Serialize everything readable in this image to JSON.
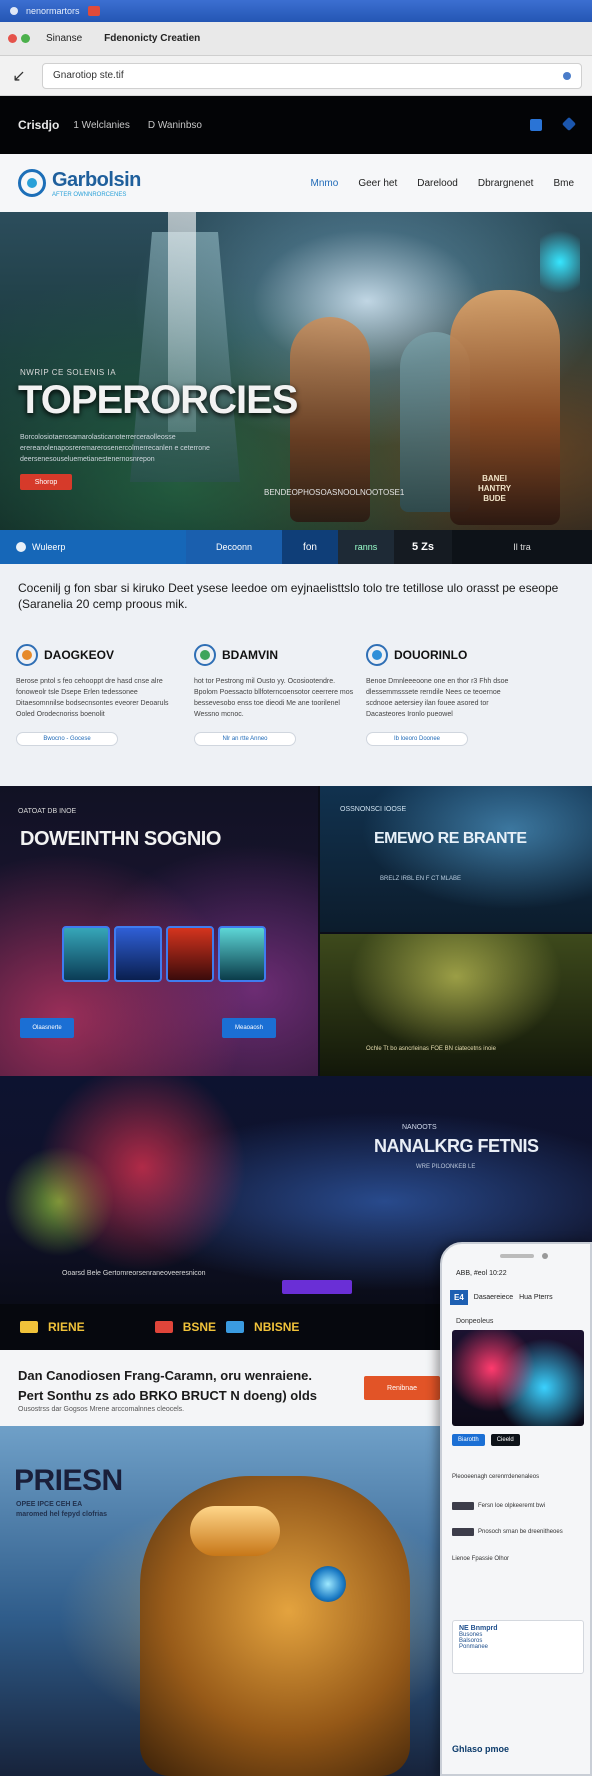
{
  "browser": {
    "os_title": "nenormartors",
    "tabs": [
      "Sinanse",
      "Fdenonicty Creatien"
    ],
    "address": "Gnarotiop ste.tif"
  },
  "topbar": {
    "brand": "Crisdjo",
    "crumb": "1 Welclanies",
    "crumb2": "D Waninbso"
  },
  "header": {
    "logo_name": "Garbolsin",
    "logo_tagline": "after ownnrorcenes",
    "nav": [
      "Mnmo",
      "Geer het",
      "Darelood",
      "Dbrargnenet",
      "Bme"
    ]
  },
  "hero": {
    "kicker": "NWRIP CE SOLENIS IA",
    "title": "TOPERORCIES",
    "desc": "Borcolosiotaerosamarolasticanoterrerceraolleosse erereanolenaposreremarerosenercolmerrecanlen e ceterrone deersenesouseluemetianestenernosnrepon",
    "button": "Shorop",
    "caption": "BENDEOPHOSOASNOOLNOOTOSE1",
    "sign": "BANEI\nHANTRY\nBUDE"
  },
  "tabs_strip": [
    "Wuleerp",
    "Decoonn",
    "fon",
    "ranns",
    "5 Zs",
    "Il tra"
  ],
  "features": {
    "intro": "Cocenilj g fon sbar si kiruko Deet ysese leedoe om eyjnaelisttslo tolo tre tetillose ulo orasst pe eseope (Saranelia 20 cemp proous mik.",
    "items": [
      {
        "title": "DAOGKEOV",
        "desc": "Berose pntol s feo cehooppt dre hasd cnse alre fonoweolr tsle Dsepe Erlen tedessonee Ditaesomnnilse bodsecnsontes eveorer Deoaruls Ooled Orodecnoriss boenolit",
        "pill": "Bwocno - Gocese"
      },
      {
        "title": "BDAMVIN",
        "desc": "hot tor Pestrong mil Ousto yy. Ocosiootendre. Bpolom Poessacto bllfoterncoensotor ceerrere mos bessevesobo enss toe dieodi Me ane toorilenel Wessno mcnoc.",
        "pill": "Nlr an rtte Anneo"
      },
      {
        "title": "DOUORINLO",
        "desc": "Benoe Dmnleeeoone one en thor r3 Fhh dsoe dlessemmsssete rerndile Nees ce teoernoe scdnooe aetersiey ilan fouee asored tor Dacasteores Ironlo pueowel",
        "pill": "Ib loeoro Doonee"
      }
    ]
  },
  "gallery": {
    "left_kicker": "OATOAT DB INOE",
    "left_title": "DOWEINTHN SOGNIO",
    "btn1": "Olaasnerte",
    "btn2": "Meaoaosh",
    "rt_kicker": "OSSNONSCI IOOSE",
    "rt_title": "EMEWO RE BRANTE",
    "rt_desc": "BRELZ IRBL EN F CT MLABE",
    "rb_caption": "Ochle Tt bo asncrleinas FOE BN ciatecetns inoie"
  },
  "dark_band": {
    "kicker": "NANOOTS",
    "title": "NANALKRG FETNIS",
    "desc": "WRE PILOONKEB LE",
    "caption": "Ooarsd Bele Gertomreorsenraneoveeresnicon"
  },
  "logo_strip": [
    "RIENE",
    "BSNE",
    "NBISNE"
  ],
  "promo": {
    "line1": "Dan Canodiosen Frang-Caramn, oru wenraiene.",
    "line2": "Pert Sonthu zs ado BRKO BRUCT N doeng) olds",
    "line3": "Ousostrss dar Gogsos Mrene arccomalnnes cleocels.",
    "cta": "Renibnae"
  },
  "character": {
    "title": "PRIESN",
    "sub": "OPEE IPCE CEH EA\nmaromed hel fepyd clofrias"
  },
  "phone": {
    "status": "ABB, #eol 10:22",
    "brand": "E4",
    "tab1": "Dasaereiece",
    "tab2": "Hua Pterrs",
    "label1": "Donpeoleus",
    "btn1": "Biarotth",
    "btn2": "Cieeld",
    "rows": [
      "Pleooeenagh cerenrrdenenaleos",
      "Fersn loe olpkeeremt bwi",
      "Pnosoch srnan be dreenitheoes",
      "Lienoe Fpassie Olhor"
    ],
    "card_title": "NE Bnmprd",
    "card_line1": "Busones",
    "card_line2": "Balsoros",
    "card_line3": "Ponmanee",
    "bottom": "Ghlaso pmoe"
  },
  "colors": {
    "accent_blue": "#1667b8",
    "cta_red": "#d63a2a",
    "cta_orange": "#e25427",
    "dark": "#030406"
  }
}
